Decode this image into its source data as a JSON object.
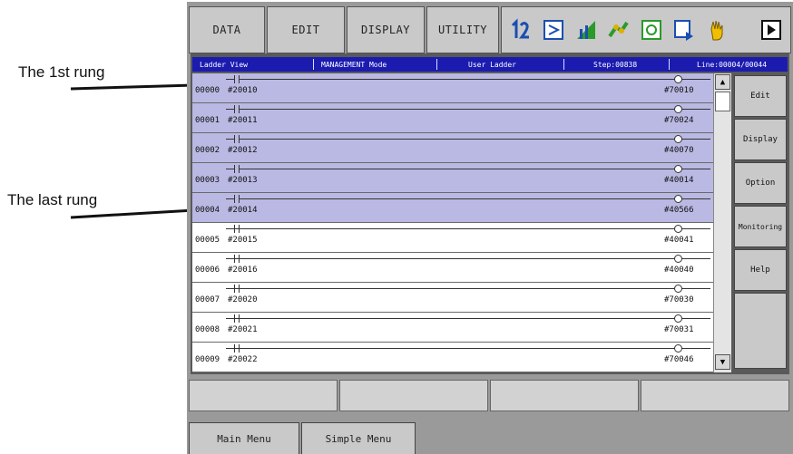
{
  "annotations": {
    "first_rung": "The 1st rung",
    "last_rung": "The last rung"
  },
  "menu": {
    "tabs": [
      "DATA",
      "EDIT",
      "DISPLAY",
      "UTILITY"
    ],
    "toolbar_icons": [
      "servo-icon",
      "job-icon",
      "io-monitor-icon",
      "robot-icon",
      "variable-icon",
      "edit-icon",
      "hand-icon",
      "play-icon"
    ]
  },
  "titlebar": {
    "view": "Ladder View",
    "mode": "MANAGEMENT Mode",
    "program": "User Ladder",
    "step": "Step:00838",
    "line": "Line:00004/00044"
  },
  "rungs": [
    {
      "num": "00000",
      "contact": "#20010",
      "coil": "#70010",
      "highlight": true
    },
    {
      "num": "00001",
      "contact": "#20011",
      "coil": "#70024",
      "highlight": true
    },
    {
      "num": "00002",
      "contact": "#20012",
      "coil": "#40070",
      "highlight": true
    },
    {
      "num": "00003",
      "contact": "#20013",
      "coil": "#40014",
      "highlight": true
    },
    {
      "num": "00004",
      "contact": "#20014",
      "coil": "#40566",
      "highlight": true
    },
    {
      "num": "00005",
      "contact": "#20015",
      "coil": "#40041",
      "highlight": false
    },
    {
      "num": "00006",
      "contact": "#20016",
      "coil": "#40040",
      "highlight": false
    },
    {
      "num": "00007",
      "contact": "#20020",
      "coil": "#70030",
      "highlight": false
    },
    {
      "num": "00008",
      "contact": "#20021",
      "coil": "#70031",
      "highlight": false
    },
    {
      "num": "00009",
      "contact": "#20022",
      "coil": "#70046",
      "highlight": false
    }
  ],
  "side_buttons": [
    "Edit",
    "Display",
    "Option",
    "Monitoring",
    "Help"
  ],
  "bottom_tabs": [
    "Main Menu",
    "Simple Menu"
  ],
  "colors": {
    "highlight": "#b9b9e3",
    "titlebar": "#1b1bb0"
  }
}
